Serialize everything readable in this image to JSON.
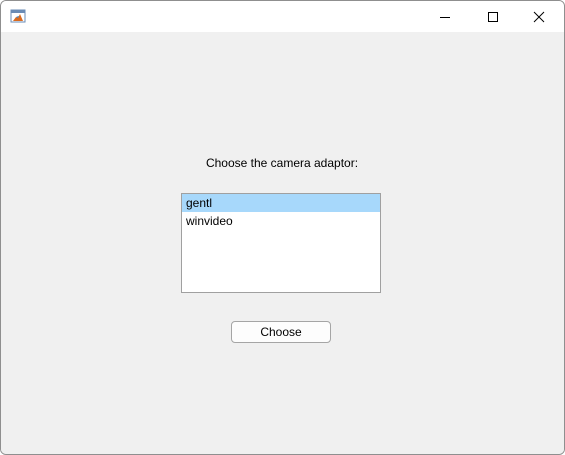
{
  "window": {
    "title": "",
    "app_icon": "matlab-logo-icon",
    "controls": {
      "minimize_icon": "minimize-icon",
      "maximize_icon": "maximize-icon",
      "close_icon": "close-icon"
    }
  },
  "dialog": {
    "prompt": "Choose the camera adaptor:",
    "adaptors": [
      {
        "label": "gentl",
        "selected": true
      },
      {
        "label": "winvideo",
        "selected": false
      }
    ],
    "choose_label": "Choose"
  },
  "colors": {
    "selection": "#a7d8fb",
    "background": "#f0f0f0"
  }
}
